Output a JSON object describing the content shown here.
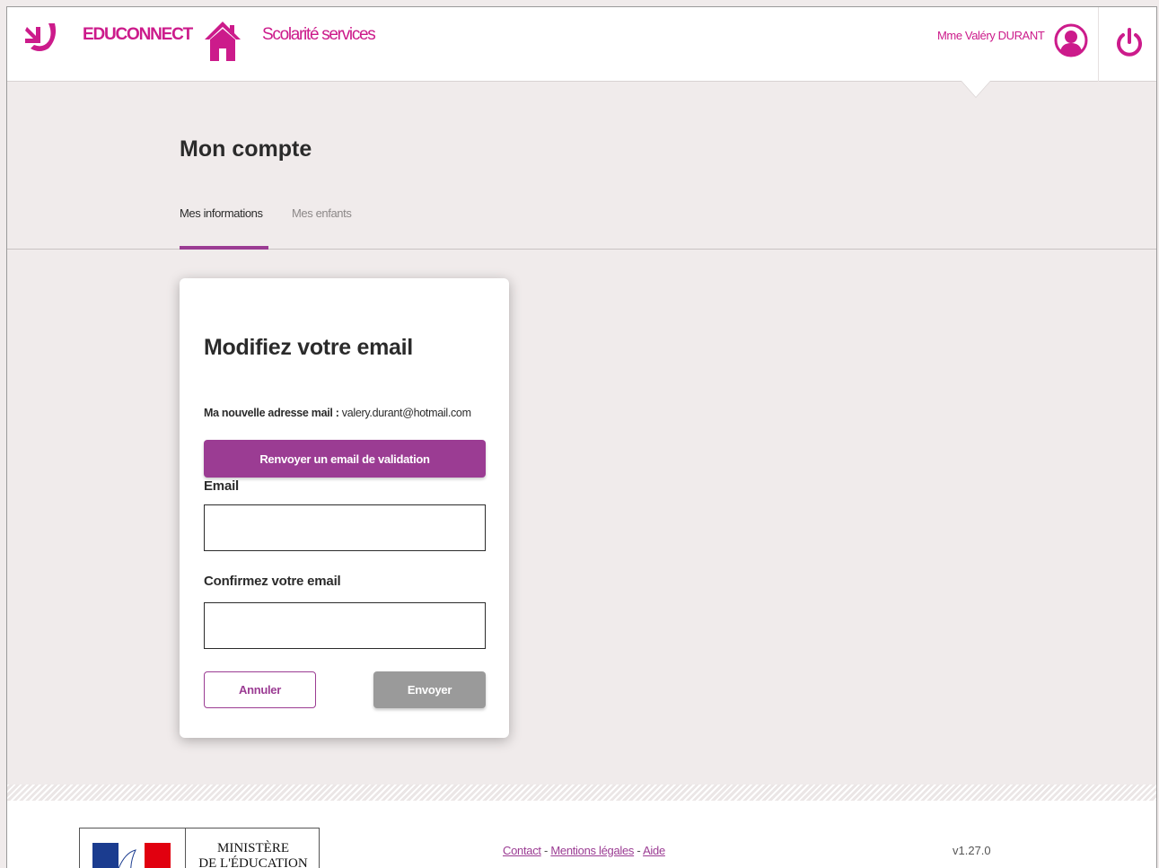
{
  "header": {
    "brand": "EDUCONNECT",
    "service": "Scolarité services",
    "user_name": "Mme Valéry DURANT",
    "icons": [
      "educonnect-logo-icon",
      "home-icon",
      "user-avatar-icon",
      "power-icon"
    ]
  },
  "page": {
    "title": "Mon compte",
    "tabs": [
      {
        "label": "Mes informations",
        "active": true
      },
      {
        "label": "Mes enfants",
        "active": false
      }
    ]
  },
  "card": {
    "title": "Modifiez votre email",
    "new_mail_label": "Ma nouvelle adresse mail :",
    "new_mail_value": "valery.durant@hotmail.com",
    "resend_label": "Renvoyer un email de validation",
    "email_label": "Email",
    "email_value": "",
    "confirm_label": "Confirmez votre email",
    "confirm_value": "",
    "cancel_label": "Annuler",
    "send_label": "Envoyer"
  },
  "footer": {
    "gov_line1": "MINISTÈRE",
    "gov_line2": "DE L'ÉDUCATION",
    "links": [
      "Contact",
      "Mentions légales",
      "Aide"
    ],
    "separator": " - ",
    "version": "v1.27.0"
  },
  "colors": {
    "brand_pink": "#cc1b8b",
    "accent_purple": "#9b3c93",
    "background": "#f0ebeb",
    "disabled_grey": "#9a9a9a"
  }
}
